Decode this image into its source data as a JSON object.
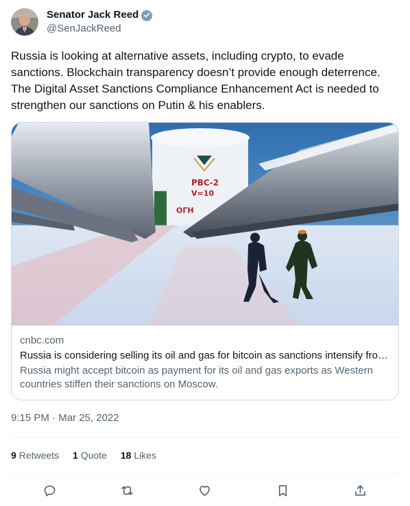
{
  "author": {
    "display_name": "Senator Jack Reed",
    "handle": "@SenJackReed",
    "verified_badge_color": "#829aab"
  },
  "tweet": {
    "text": "Russia is looking at alternative assets, including crypto, to evade sanctions. Blockchain transparency doesn’t provide enough deterrence. The Digital Asset Sanctions Compliance Enhancement Act is needed to strengthen our sanctions on Putin & his enablers.",
    "timestamp": {
      "time": "9:15 PM",
      "separator": " · ",
      "date": "Mar 25, 2022"
    }
  },
  "link_card": {
    "domain": "cnbc.com",
    "title": "Russia is considering selling its oil and gas for bitcoin as sanctions intensify from the West",
    "description": "Russia might accept bitcoin as payment for its oil and gas exports as Western countries stiffen their sanctions on Moscow.",
    "image_tank_text_1": "РВС-2",
    "image_tank_text_2": "V=10",
    "image_tank_text_3": "ОГН"
  },
  "stats": {
    "retweets_count": "9",
    "retweets_label": " Retweets",
    "quotes_count": "1",
    "quotes_label": " Quote",
    "likes_count": "18",
    "likes_label": " Likes"
  },
  "actions": {
    "icons": [
      "reply-icon",
      "retweet-icon",
      "like-icon",
      "bookmark-icon",
      "share-icon"
    ],
    "icon_color": "#536471"
  },
  "colors": {
    "text_primary": "#0f1419",
    "text_secondary": "#536471",
    "border": "#cfd9de",
    "divider": "#eff3f4"
  }
}
